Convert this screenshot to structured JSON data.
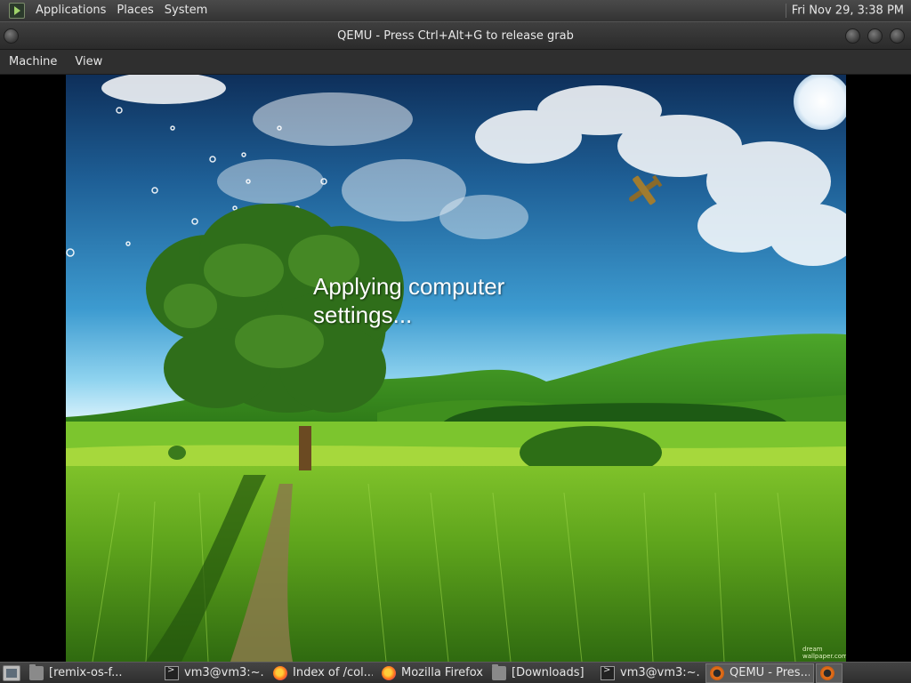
{
  "top_panel": {
    "menus": [
      "Applications",
      "Places",
      "System"
    ],
    "clock": "Fri Nov 29,  3:38 PM"
  },
  "window": {
    "title": "QEMU - Press Ctrl+Alt+G to release grab",
    "menu": [
      "Machine",
      "View"
    ]
  },
  "vm_screen": {
    "status_text": "Applying computer settings...",
    "wallpaper_credit": "dream wallpaper.com"
  },
  "taskbar": {
    "tasks": [
      {
        "label": "[remix-os-f...",
        "icon": "folder-icon"
      },
      {
        "label": "vm3@vm3:~...",
        "icon": "terminal-icon"
      },
      {
        "label": "Index of /col...",
        "icon": "firefox-icon"
      },
      {
        "label": "Mozilla Firefox",
        "icon": "firefox-icon"
      },
      {
        "label": "[Downloads]",
        "icon": "folder-icon"
      },
      {
        "label": "vm3@vm3:~...",
        "icon": "terminal-icon"
      },
      {
        "label": "QEMU - Pres...",
        "icon": "qemu-icon",
        "active": true
      },
      {
        "label": "",
        "icon": "qemu-icon",
        "active": true
      }
    ]
  }
}
